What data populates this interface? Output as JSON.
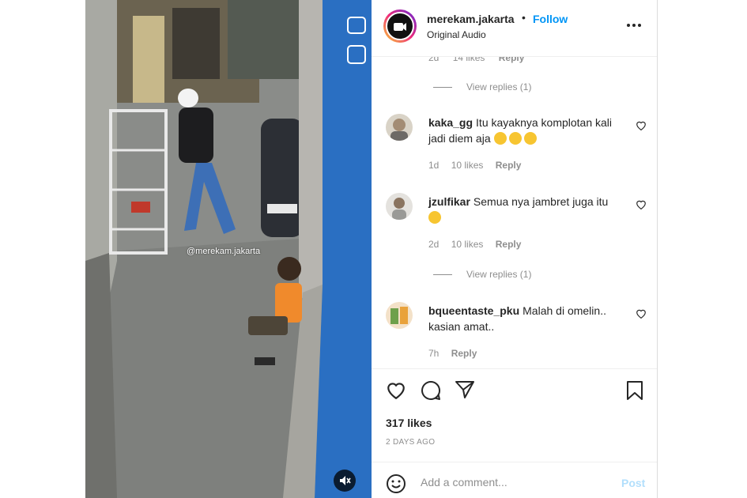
{
  "post": {
    "username": "merekam.jakarta",
    "separator": "•",
    "follow_label": "Follow",
    "audio_label": "Original Audio",
    "watermark": "@merekam.jakarta"
  },
  "comments": {
    "partial_meta": {
      "time": "2d",
      "likes": "14 likes",
      "reply": "Reply"
    },
    "view_replies_top": "View replies (1)",
    "items": [
      {
        "username": "kaka_gg",
        "text": "Itu kayaknya komplotan kali jadi diem aja",
        "emoji_count": 3,
        "time": "1d",
        "likes": "10 likes",
        "reply": "Reply"
      },
      {
        "username": "jzulfikar",
        "text": "Semua nya jambret juga itu",
        "emoji_count": 1,
        "time": "2d",
        "likes": "10 likes",
        "reply": "Reply",
        "view_replies": "View replies (1)"
      },
      {
        "username": "bqueentaste_pku",
        "text": "Malah di omelin.. kasian amat..",
        "emoji_count": 0,
        "time": "7h",
        "reply": "Reply"
      }
    ]
  },
  "footer": {
    "likes": "317 likes",
    "date": "2 DAYS AGO",
    "add_comment_placeholder": "Add a comment...",
    "post_label": "Post"
  },
  "icons": {
    "like": "heart-icon",
    "comment": "comment-icon",
    "share": "send-icon",
    "save": "bookmark-icon",
    "emoji": "smiley-icon",
    "more": "more-dots-icon",
    "mute": "muted-speaker-icon"
  },
  "colors": {
    "accent": "#0095f6",
    "post_disabled": "#b2dffc",
    "muted_text": "#8e8e8e",
    "text": "#262626"
  }
}
